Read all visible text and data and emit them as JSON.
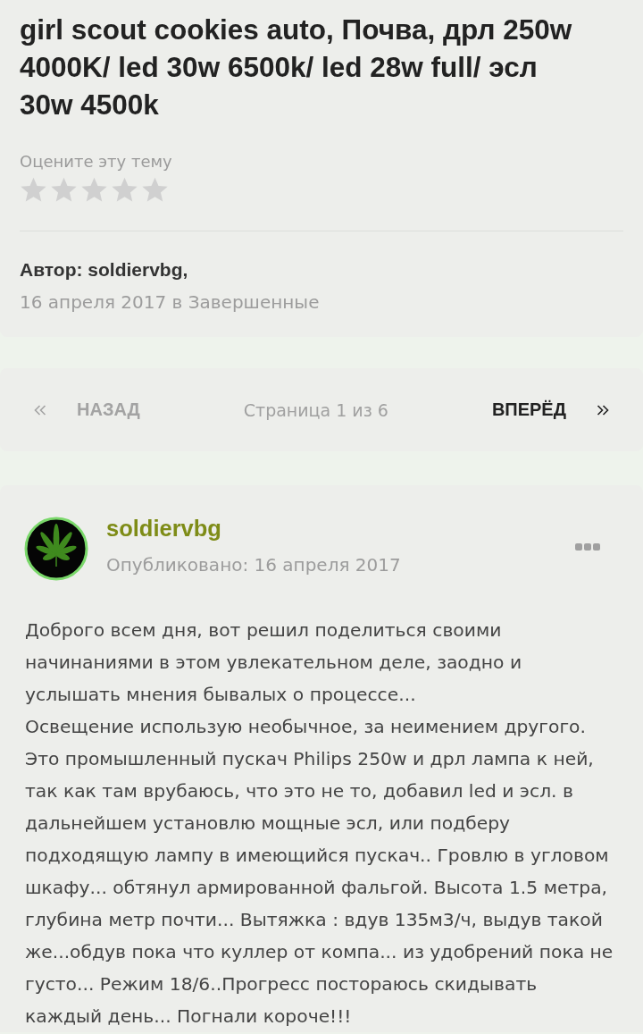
{
  "topic": {
    "title": "girl scout cookies auto, Почва, дрл 250w 4000K/ led 30w 6500k/ led 28w full/ эсл 30w 4500k",
    "rating_label": "Оцените эту тему",
    "stars": 0,
    "author": "Автор: soldiervbg,",
    "meta": "16 апреля 2017 в Завершенные"
  },
  "pagination": {
    "prev": {
      "label": "НАЗАД",
      "disabled": true
    },
    "page_info": "Страница 1 из 6",
    "next": {
      "label": "ВПЕРЁД",
      "disabled": false
    }
  },
  "post": {
    "username": "soldiervbg",
    "published": "Опубликовано: 16 апреля 2017",
    "paragraphs": [
      "Доброго всем дня, вот решил поделиться своими начинаниями в этом увлекательном деле, заодно и услышать мнения бывалых о процессе...",
      "Освещение использую необычное, за неимением другого. Это промышленный пускач Philips 250w и дрл лампа к ней, так как там врубаюсь, что это не то, добавил led и эсл. в дальнейшем установлю мощные эсл, или подберу подходящую лампу в имеющийся пускач.. Гровлю в угловом шкафу... обтянул армированной фальгой. Высота 1.5 метра, глубина метр почти... Вытяжка : вдув 135м3/ч, выдув такой же...обдув пока что куллер от компа... из удобрений пока не густо... Режим 18/6..Прогресс постораюсь скидывать каждый день... Погнали короче!!!"
    ]
  }
}
